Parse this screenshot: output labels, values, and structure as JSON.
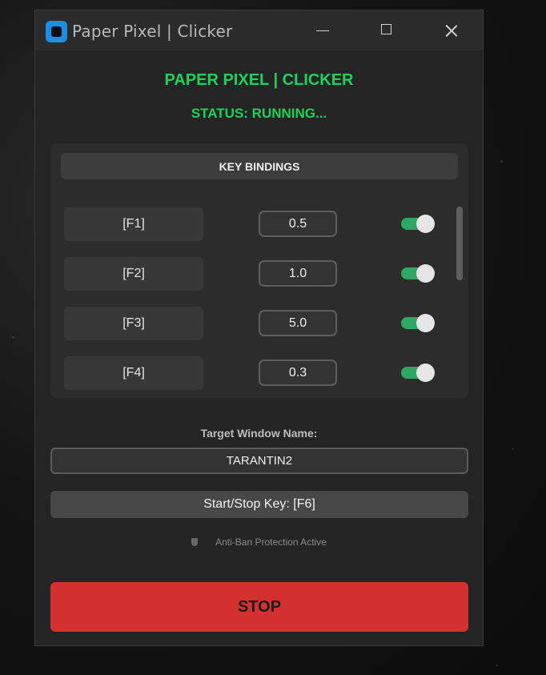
{
  "window": {
    "title": "Paper Pixel | Clicker"
  },
  "app": {
    "heading": "PAPER PIXEL | CLICKER",
    "status": "STATUS: RUNNING..."
  },
  "bindings": {
    "header": "KEY BINDINGS",
    "rows": [
      {
        "key": "[F1]",
        "value": "0.5",
        "enabled": true
      },
      {
        "key": "[F2]",
        "value": "1.0",
        "enabled": true
      },
      {
        "key": "[F3]",
        "value": "5.0",
        "enabled": true
      },
      {
        "key": "[F4]",
        "value": "0.3",
        "enabled": true
      }
    ]
  },
  "target": {
    "label": "Target Window Name:",
    "value": "TARANTIN2"
  },
  "start_stop": {
    "label": "Start/Stop Key: [F6]"
  },
  "anti_ban": {
    "text": "Anti-Ban Protection Active"
  },
  "stop_button": {
    "label": "STOP"
  },
  "colors": {
    "accent_green": "#1fd15a",
    "toggle_on": "#2fa866",
    "stop_red": "#d3302f"
  },
  "icons": {
    "app": "app-logo-icon",
    "minimize": "minimize-icon",
    "maximize": "maximize-icon",
    "close": "close-icon",
    "shield": "shield-icon"
  }
}
